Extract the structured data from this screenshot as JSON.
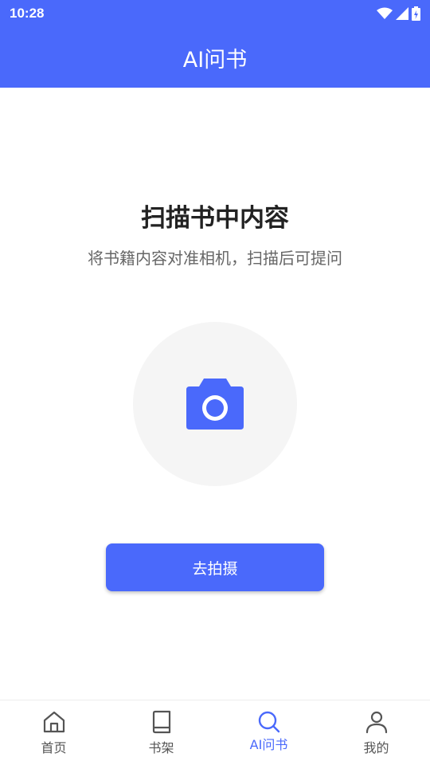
{
  "status_bar": {
    "time": "10:28"
  },
  "app_bar": {
    "title": "AI问书"
  },
  "main": {
    "headline": "扫描书中内容",
    "subline": "将书籍内容对准相机，扫描后可提问",
    "shoot_button": "去拍摄"
  },
  "bottom_nav": {
    "items": [
      {
        "label": "首页",
        "icon": "home-icon"
      },
      {
        "label": "书架",
        "icon": "book-icon"
      },
      {
        "label": "AI问书",
        "icon": "search-icon",
        "active": true
      },
      {
        "label": "我的",
        "icon": "person-icon"
      }
    ]
  },
  "colors": {
    "accent": "#4a69fb",
    "circle_bg": "#f5f5f5"
  }
}
